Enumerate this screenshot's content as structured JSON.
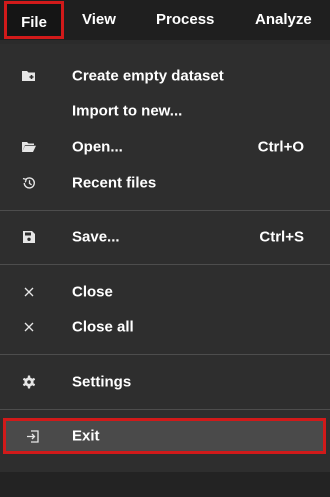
{
  "menubar": {
    "items": [
      {
        "label": "File"
      },
      {
        "label": "View"
      },
      {
        "label": "Process"
      },
      {
        "label": "Analyze"
      }
    ]
  },
  "file_menu": {
    "items": [
      {
        "label": "Create empty dataset",
        "icon": "new-folder-icon"
      },
      {
        "label": "Import to new...",
        "icon": ""
      },
      {
        "label": "Open...",
        "shortcut": "Ctrl+O",
        "icon": "folder-open-icon"
      },
      {
        "label": "Recent files",
        "icon": "history-icon"
      },
      {
        "label": "Save...",
        "shortcut": "Ctrl+S",
        "icon": "save-icon"
      },
      {
        "label": "Close",
        "icon": "close-icon"
      },
      {
        "label": "Close all",
        "icon": "close-icon"
      },
      {
        "label": "Settings",
        "icon": "gear-icon"
      },
      {
        "label": "Exit",
        "icon": "exit-icon"
      }
    ]
  },
  "colors": {
    "highlight_border": "#d11a1a",
    "menu_background": "#2e2e2e",
    "menubar_background": "#1f1f1f"
  }
}
